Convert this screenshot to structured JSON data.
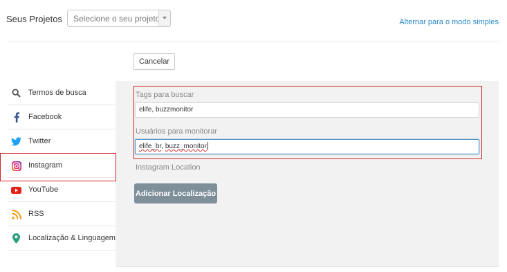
{
  "header": {
    "projects_label": "Seus Projetos",
    "project_select_placeholder": "Selecione o seu projeto",
    "simple_mode_link": "Alternar para o modo simples"
  },
  "actions": {
    "cancel_label": "Cancelar",
    "add_location_label": "Adicionar Localização"
  },
  "sidebar": {
    "items": [
      {
        "label": "Termos de busca",
        "icon": "search-icon",
        "color": "#555555"
      },
      {
        "label": "Facebook",
        "icon": "facebook-icon",
        "color": "#3b5998"
      },
      {
        "label": "Twitter",
        "icon": "twitter-icon",
        "color": "#1da1f2"
      },
      {
        "label": "Instagram",
        "icon": "instagram-icon",
        "color": "#e1306c",
        "selected": true
      },
      {
        "label": "YouTube",
        "icon": "youtube-icon",
        "color": "#e62117"
      },
      {
        "label": "RSS",
        "icon": "rss-icon",
        "color": "#f39c12"
      },
      {
        "label": "Localização & Linguagem",
        "icon": "location-pin-icon",
        "color": "#2e9e7f"
      }
    ]
  },
  "form": {
    "tags_label": "Tags para buscar",
    "tags_value": "elife, buzzmonitor",
    "users_label": "Usuários para monitorar",
    "users_value_part1": "elife_br",
    "users_value_sep": ", ",
    "users_value_part2": "buzz_monitor",
    "location_label": "Instagram Location"
  },
  "colors": {
    "accent_link": "#2a87c8",
    "highlight_border": "#cf2525",
    "button_gray": "#7f8f99"
  }
}
